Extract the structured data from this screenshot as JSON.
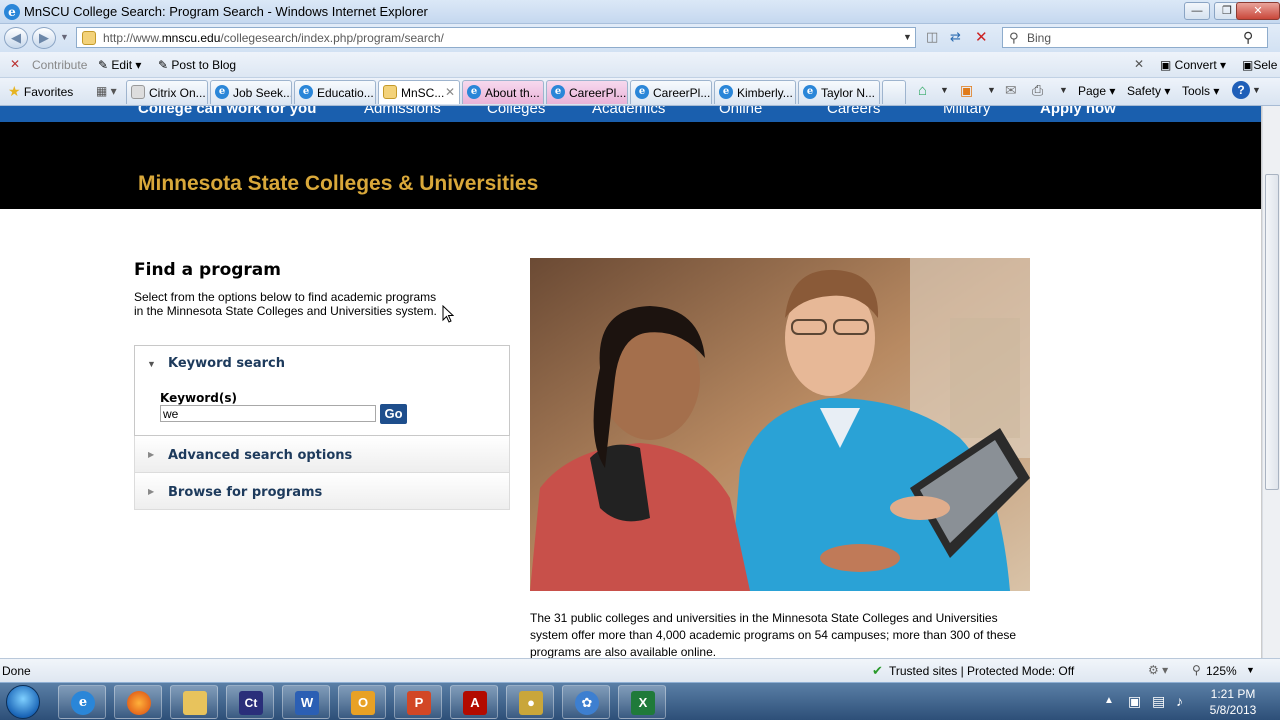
{
  "window": {
    "title": "MnSCU College Search: Program Search - Windows Internet Explorer"
  },
  "address": {
    "url_prefix": "http://www.",
    "url_domain": "mnscu.edu",
    "url_path": "/collegesearch/index.php/program/search/",
    "search_placeholder": "Bing"
  },
  "command_bar": {
    "contribute": "Contribute",
    "edit": "Edit",
    "post_to_blog": "Post to Blog",
    "convert": "Convert",
    "select": "Sele"
  },
  "favorites_bar": {
    "favorites": "Favorites",
    "tabs": [
      "Citrix On...",
      "Job Seek...",
      "Educatio...",
      "MnSC...",
      "About th...",
      "CareerPl...",
      "CareerPl...",
      "Kimberly...",
      "Taylor N..."
    ],
    "tools": {
      "page": "Page",
      "safety": "Safety",
      "tools": "Tools"
    }
  },
  "site": {
    "nav": [
      "College can work for you",
      "Admissions",
      "Colleges",
      "Academics",
      "Online",
      "Careers",
      "Military",
      "Apply now"
    ],
    "title": "Minnesota State Colleges & Universities"
  },
  "main": {
    "heading": "Find a program",
    "description": "Select from the options below to find academic programs in the Minnesota State Colleges and Universities system.",
    "keyword_search": {
      "heading": "Keyword search",
      "label": "Keyword(s)",
      "value": "we",
      "go_label": "Go"
    },
    "advanced_heading": "Advanced search options",
    "browse_heading": "Browse for programs",
    "body_text": "The 31 public colleges and universities in the Minnesota State Colleges and Universities system offer more than 4,000 academic programs on 54 campuses; more than 300 of these programs are also available online."
  },
  "status_bar": {
    "status": "Done",
    "zone": "Trusted sites | Protected Mode: Off",
    "zoom": "125%"
  },
  "taskbar": {
    "time": "1:21 PM",
    "date": "5/8/2013"
  },
  "colors": {
    "site_title": "#d9a83a",
    "nav_bar": "#1a5fae",
    "go_button": "#1e4e8c"
  }
}
